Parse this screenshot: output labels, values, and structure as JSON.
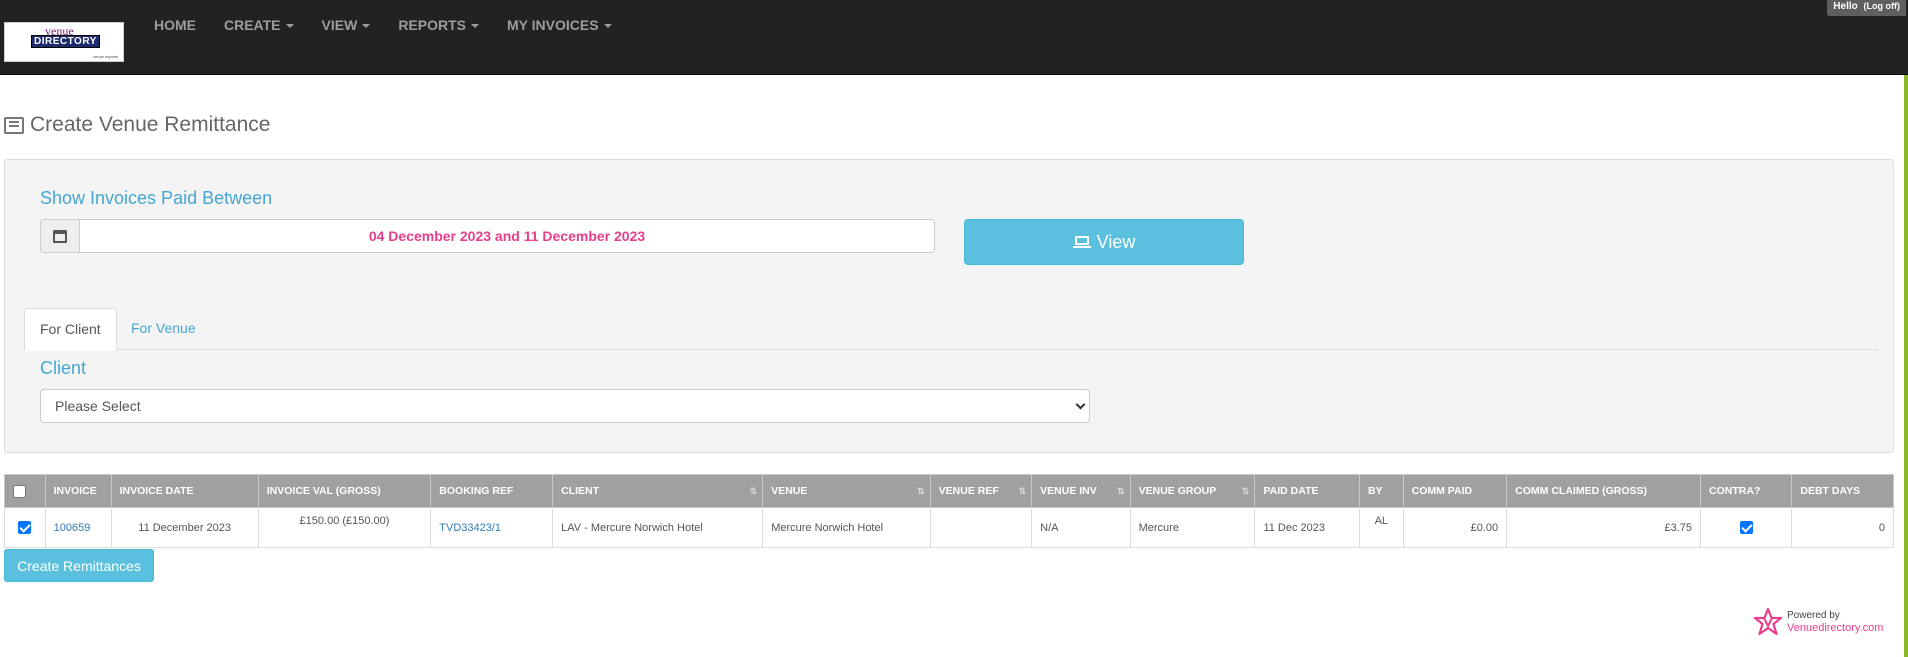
{
  "nav": {
    "logo_line1": "venue",
    "logo_line2": "DIRECTORY",
    "logo_line3": "venue experts",
    "items": [
      "HOME",
      "CREATE",
      "VIEW",
      "REPORTS",
      "MY INVOICES"
    ],
    "hello": "Hello",
    "logoff": "(Log off)"
  },
  "page": {
    "title": "Create Venue Remittance"
  },
  "filter": {
    "label": "Show Invoices Paid Between",
    "date_range": "04 December 2023 and 11 December 2023",
    "view_button": "View"
  },
  "tabs": [
    "For Client",
    "For Venue"
  ],
  "client": {
    "label": "Client",
    "selected": "Please Select"
  },
  "table": {
    "headers": [
      "INVOICE",
      "INVOICE DATE",
      "INVOICE VAL (GROSS)",
      "BOOKING REF",
      "CLIENT",
      "VENUE",
      "VENUE REF",
      "VENUE INV",
      "VENUE GROUP",
      "PAID DATE",
      "BY",
      "COMM PAID",
      "COMM CLAIMED (GROSS)",
      "CONTRA?",
      "DEBT DAYS"
    ],
    "rows": [
      {
        "selected": true,
        "invoice": "100659",
        "invoice_date": "11 December 2023",
        "invoice_val": "£150.00 (£150.00)",
        "booking_ref": "TVD33423/1",
        "client": "LAV - Mercure Norwich Hotel",
        "venue": "Mercure Norwich Hotel",
        "venue_ref": "",
        "venue_inv": "N/A",
        "venue_group": "Mercure",
        "paid_date": "11 Dec 2023",
        "by": "AL",
        "comm_paid": "£0.00",
        "comm_claimed": "£3.75",
        "contra": true,
        "debt_days": "0"
      }
    ]
  },
  "create_button": "Create Remittances",
  "footer": {
    "powered_by": "Powered by",
    "brand": "Venuedirectory.com"
  },
  "colors": {
    "accent": "#5bc0de",
    "link": "#46a6d1",
    "pink": "#e83e8c",
    "navbar": "#222222"
  }
}
